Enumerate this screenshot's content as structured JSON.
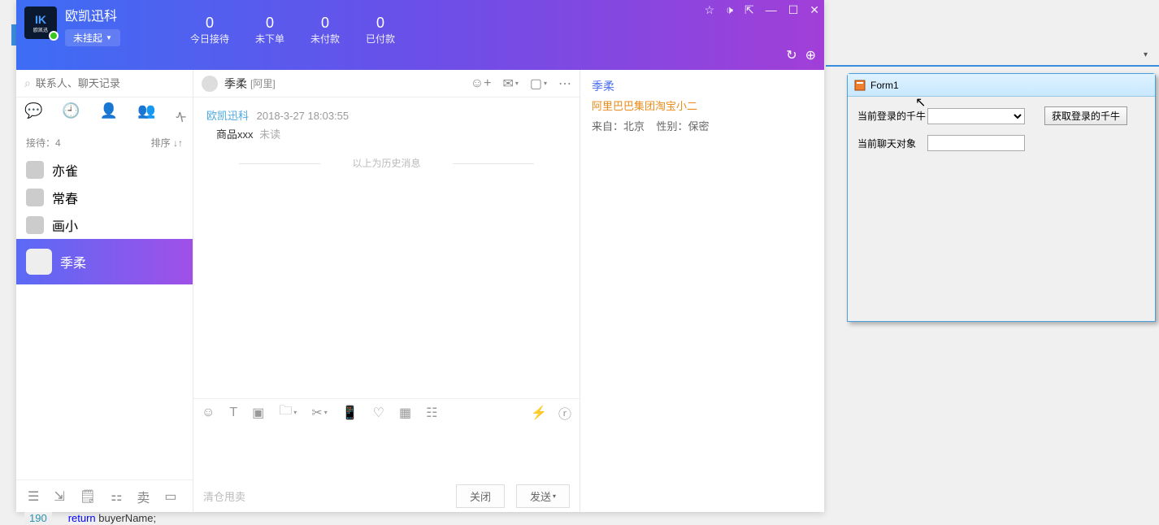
{
  "app": {
    "title": "欧凯迅科",
    "status": "未挂起"
  },
  "stats": [
    {
      "num": "0",
      "label": "今日接待"
    },
    {
      "num": "0",
      "label": "未下单"
    },
    {
      "num": "0",
      "label": "未付款"
    },
    {
      "num": "0",
      "label": "已付款"
    }
  ],
  "search": {
    "placeholder": "联系人、聊天记录"
  },
  "subrow": {
    "receiving": "接待：4",
    "sort": "排序 ↓↑"
  },
  "contacts": [
    {
      "name": "亦雀"
    },
    {
      "name": "常春"
    },
    {
      "name": "画小"
    },
    {
      "name": "季柔"
    }
  ],
  "bottom": {
    "sell": "卖"
  },
  "chat": {
    "name": "季柔",
    "tag": "[阿里]",
    "sender": "欧凯迅科",
    "time": "2018-3-27 18:03:55",
    "product": "商品xxx",
    "unread": "未读",
    "history_sep": "以上为历史消息",
    "hint": "清仓甩卖",
    "close": "关闭",
    "send": "发送"
  },
  "info": {
    "name": "季柔",
    "org": "阿里巴巴集团淘宝小二",
    "from_label": "来自：",
    "from_val": "北京",
    "gender_label": "性别：",
    "gender_val": "保密"
  },
  "form1": {
    "title": "Form1",
    "label1": "当前登录的千牛",
    "label2": "当前聊天对象",
    "button": "获取登录的千牛"
  },
  "code": {
    "line": "190",
    "kw": "return",
    "rest": " buyerName;"
  }
}
